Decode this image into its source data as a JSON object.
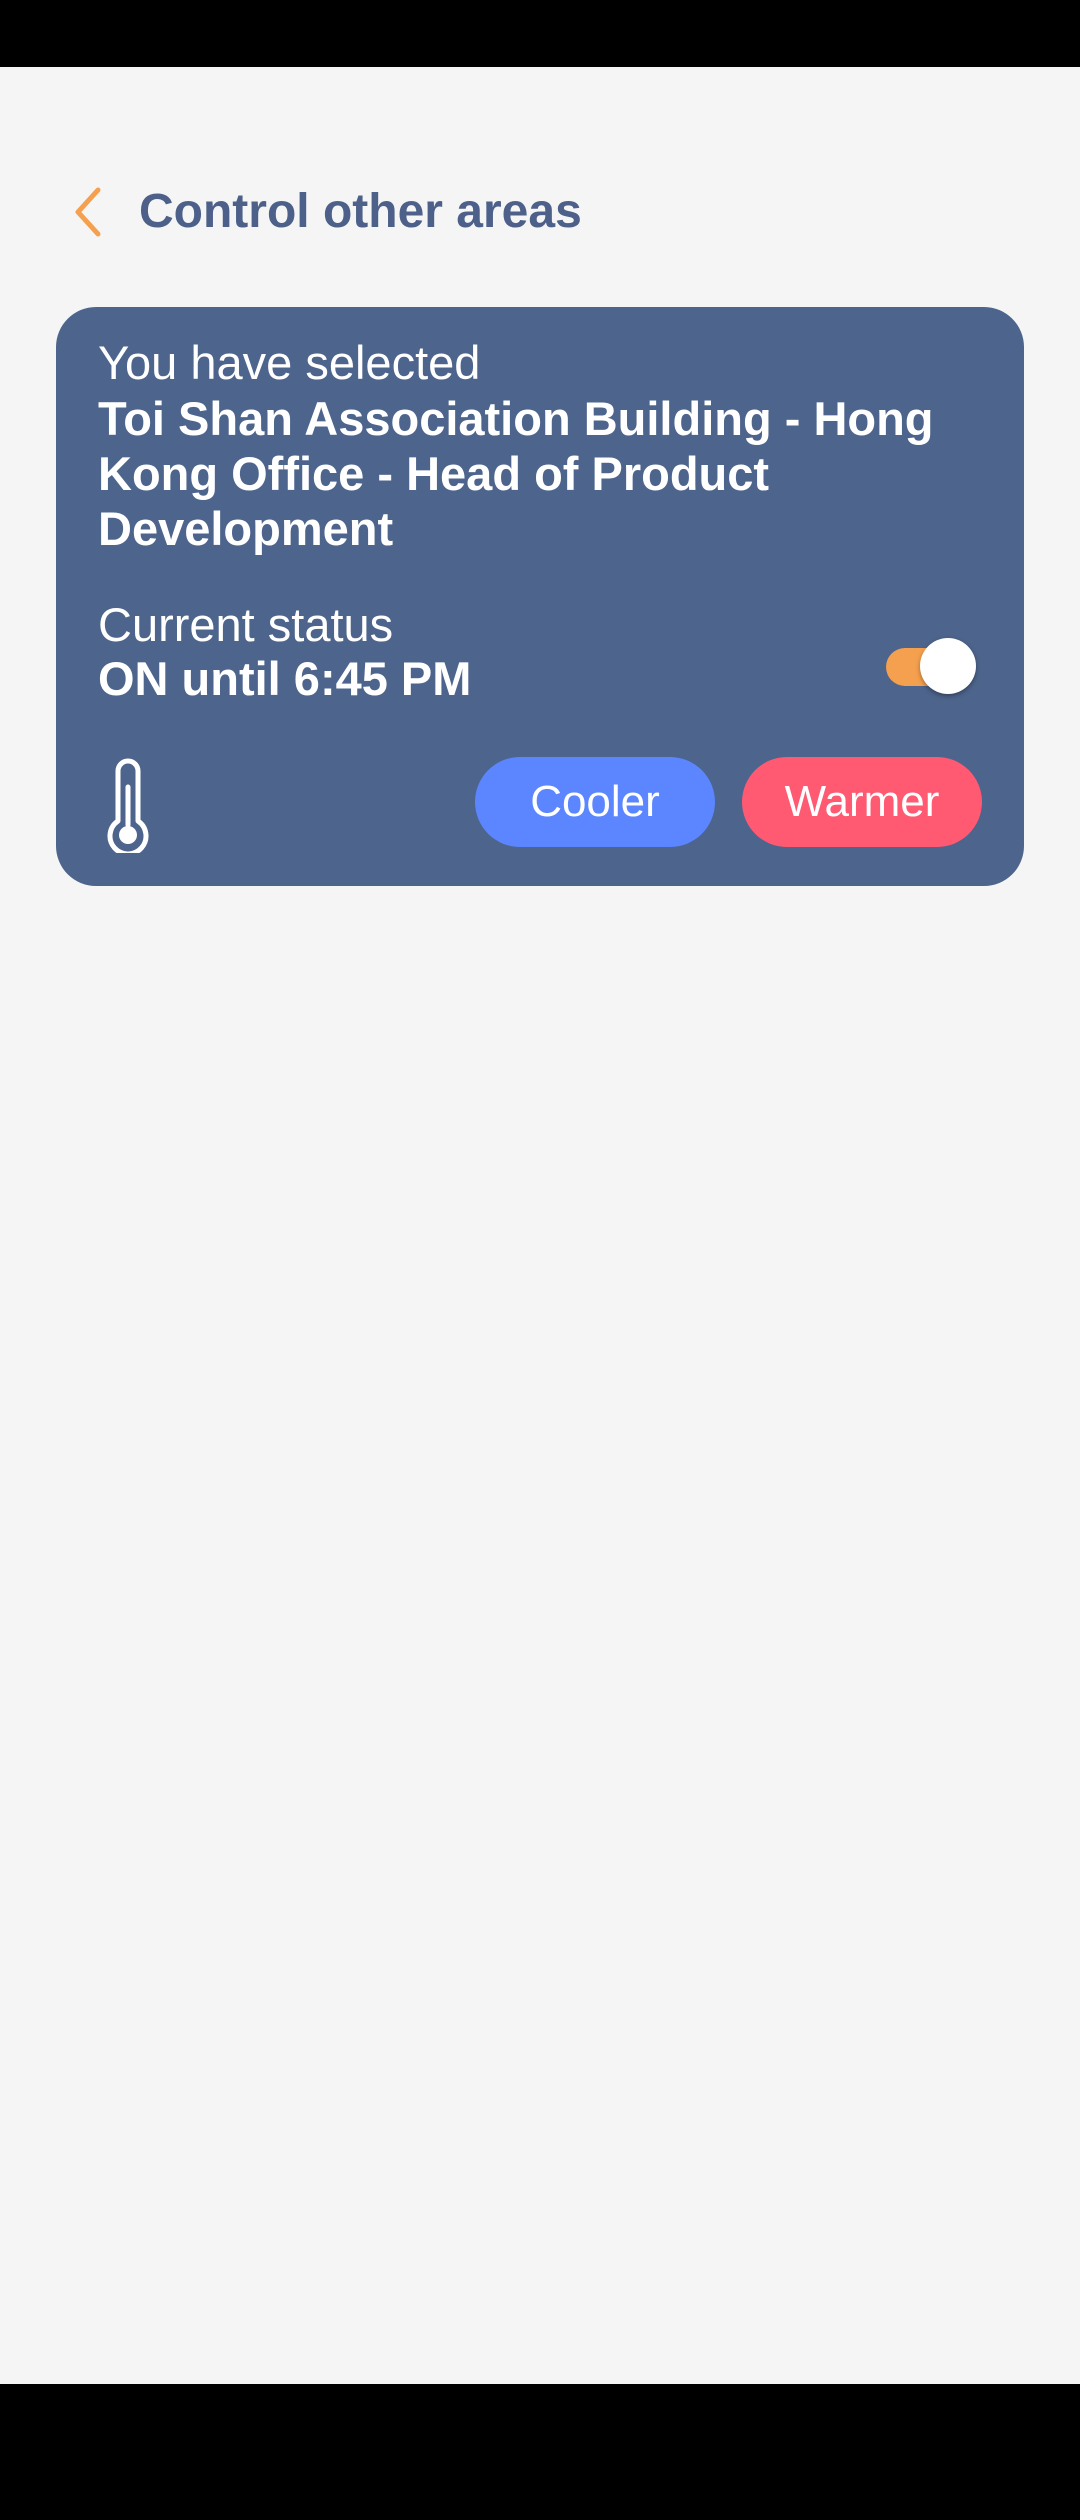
{
  "header": {
    "title": "Control other areas",
    "back_icon": "chevron-left-icon"
  },
  "card": {
    "selected_label": "You have selected",
    "selected_area": "Toi Shan Association Building - Hong Kong Office - Head of Product Development",
    "status_label": "Current status",
    "status_value": "ON until 6:45 PM",
    "toggle": {
      "on": true
    },
    "thermometer_icon": "thermometer-icon",
    "cooler_label": "Cooler",
    "warmer_label": "Warmer"
  },
  "colors": {
    "background": "#f5f5f5",
    "title": "#4d6089",
    "accent": "#f5a04e",
    "card": "#4d648c",
    "cooler": "#5b86ff",
    "warmer": "#ff5a72",
    "toggle_track_on": "#f5a04e"
  }
}
